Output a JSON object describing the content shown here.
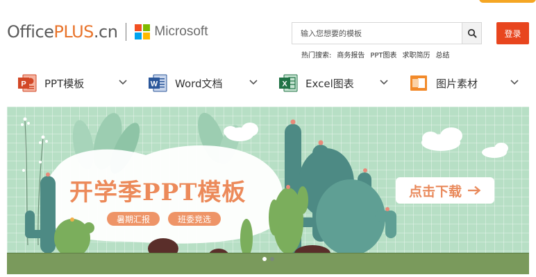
{
  "header": {
    "logo": {
      "office": "Office",
      "plus": "PLUS",
      "cn": ".cn"
    },
    "partner": "Microsoft",
    "search": {
      "placeholder": "输入您想要的模板"
    },
    "login_label": "登录",
    "hot": {
      "label": "热门搜索:",
      "items": [
        "商务报告",
        "PPT图表",
        "求职简历",
        "总结"
      ]
    }
  },
  "nav": {
    "items": [
      {
        "label": "PPT模板",
        "icon": "powerpoint-icon"
      },
      {
        "label": "Word文档",
        "icon": "word-icon"
      },
      {
        "label": "Excel图表",
        "icon": "excel-icon"
      },
      {
        "label": "图片素材",
        "icon": "picture-icon"
      }
    ]
  },
  "banner": {
    "title": "开学季PPT模板",
    "tags": [
      "暑期汇报",
      "班委竞选"
    ],
    "cta_label": "点击下载",
    "cta_icon": "arrow-right-icon",
    "slides_total": 2,
    "slide_active": 1
  },
  "colors": {
    "accent": "#e8451e",
    "brand_orange": "#e8732a",
    "banner_bg": "#b7dfc5",
    "title": "#ec8a5a",
    "ppt": "#d24726",
    "word": "#2b579a",
    "excel": "#217346",
    "picture": "#f28a2a"
  }
}
